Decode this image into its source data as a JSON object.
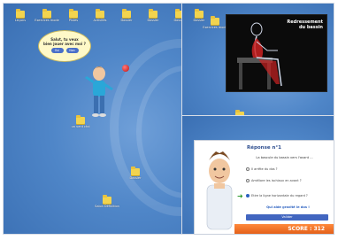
{
  "desktop_main": {
    "top_folders": [
      {
        "label": "Leçons"
      },
      {
        "label": "Exercices mode"
      },
      {
        "label": "Pistes"
      },
      {
        "label": "Activités"
      },
      {
        "label": "Dossier"
      },
      {
        "label": "Dossier"
      },
      {
        "label": "Dossier"
      }
    ],
    "folders": [
      {
        "label": "un vent chd"
      },
      {
        "label": "Dossier"
      },
      {
        "label": "Salon Définition"
      }
    ]
  },
  "desktop_topright": {
    "folders": [
      {
        "label": "Dossier"
      },
      {
        "label": "Exercices mode"
      }
    ],
    "lower_folders": [
      {
        "label": "Dossier"
      }
    ]
  },
  "bubble": {
    "line1": "Salut, tu veux",
    "line2": "bien jouer avec moi ?",
    "yes": "Oui",
    "no": "Non"
  },
  "anatomy": {
    "title_line1": "Redressement",
    "title_line2": "du bassin"
  },
  "quiz": {
    "title": "Réponse n°1",
    "question": "La bascule du bassin vers l'avant ...",
    "options": [
      {
        "label": "Il arrête du dos ?",
        "selected": false
      },
      {
        "label": "Améliore les ischiaux en avant ?",
        "selected": false
      },
      {
        "label": "Etire la ligne horizontale du regard ?",
        "selected": true
      }
    ],
    "hint": "Qui aide gravité le dos !",
    "validate": "Valider",
    "score": "SCORE : 312"
  },
  "colors": {
    "desktop_blue": "#4f86c8",
    "folder_yellow": "#f2d44f",
    "score_orange": "#ff8a3c",
    "quiz_title_blue": "#2f4f8f"
  }
}
